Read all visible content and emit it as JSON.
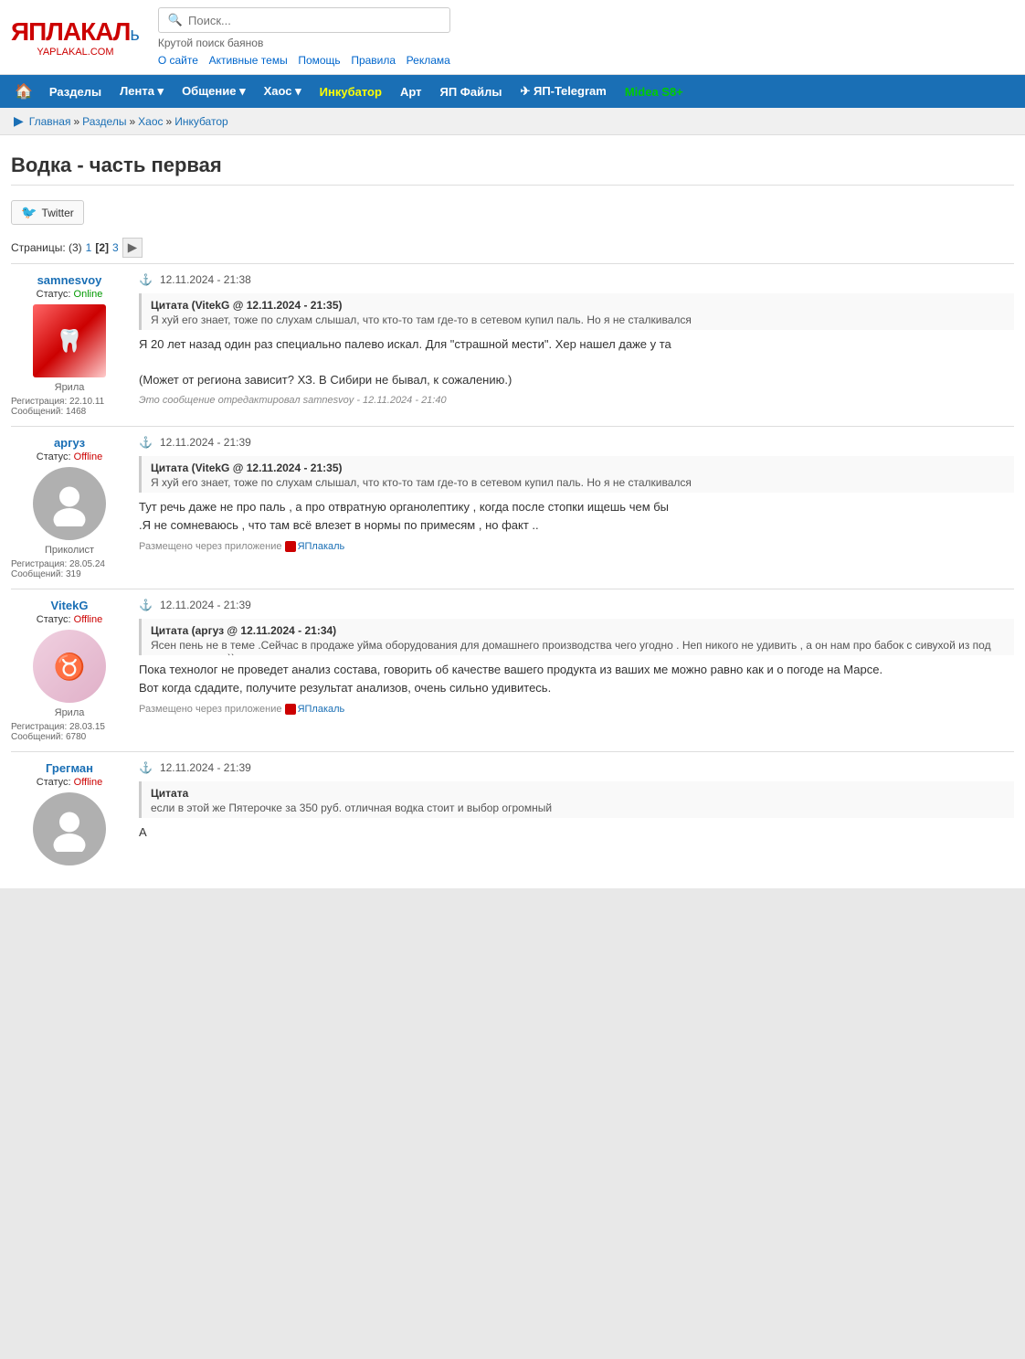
{
  "site": {
    "logo_main": "ЯПЛАКАЛ",
    "logo_sub": "YAPLAKAL.COM",
    "tagline": "Крутой поиск баянов",
    "search_placeholder": "Поиск...",
    "nav_links": [
      {
        "label": "О сайте",
        "url": "#"
      },
      {
        "label": "Активные темы",
        "url": "#"
      },
      {
        "label": "Помощь",
        "url": "#"
      },
      {
        "label": "Правила",
        "url": "#"
      },
      {
        "label": "Реклама",
        "url": "#"
      }
    ]
  },
  "topnav": {
    "items": [
      {
        "label": "Разделы",
        "has_arrow": false
      },
      {
        "label": "Лента",
        "has_arrow": true
      },
      {
        "label": "Общение",
        "has_arrow": true
      },
      {
        "label": "Хаос",
        "has_arrow": true
      },
      {
        "label": "Инкубатор",
        "special": "incubator"
      },
      {
        "label": "Арт",
        "special": "art"
      },
      {
        "label": "ЯП Файлы",
        "special": ""
      },
      {
        "label": "✈ ЯП-Telegram",
        "special": ""
      },
      {
        "label": "Midea S8+",
        "special": "midea"
      }
    ]
  },
  "breadcrumb": {
    "items": [
      {
        "label": "Главная",
        "url": "#"
      },
      {
        "label": "Разделы",
        "url": "#"
      },
      {
        "label": "Хаос",
        "url": "#"
      },
      {
        "label": "Инкубатор",
        "url": "#"
      }
    ]
  },
  "page": {
    "title": "Водка - часть первая",
    "twitter_label": "Twitter",
    "pagination": {
      "total": 3,
      "current": 2,
      "pages": [
        "1",
        "2",
        "3"
      ]
    }
  },
  "posts": [
    {
      "username": "samnesvoy",
      "status": "Online",
      "status_type": "online",
      "avatar_type": "teeth",
      "role": "Ярила",
      "reg_date": "22.10.11",
      "messages": "1468",
      "date": "12.11.2024 - 21:38",
      "has_quote": true,
      "quote_author": "VitekG",
      "quote_date": "12.11.2024 - 21:35",
      "quote_text": "Я хуй его знает, тоже по слухам слышал, что кто-то там где-то в сетевом купил паль. Но я не сталкивался",
      "text": "Я 20 лет назад один раз специально палево искал. Для \"страшной мести\". Хер нашел даже у та\n\n(Может от региона зависит? ХЗ. В Сибири не бывал, к сожалению.)",
      "has_app": false,
      "edit_note": "Это сообщение отредактировал samnesvoy - 12.11.2024 - 21:40"
    },
    {
      "username": "аргуз",
      "status": "Offline",
      "status_type": "offline",
      "avatar_type": "placeholder",
      "role": "Приколист",
      "reg_date": "28.05.24",
      "messages": "319",
      "date": "12.11.2024 - 21:39",
      "has_quote": true,
      "quote_author": "VitekG",
      "quote_date": "12.11.2024 - 21:35",
      "quote_text": "Я хуй его знает, тоже по слухам слышал, что кто-то там где-то в сетевом купил паль. Но я не сталкивался",
      "text": "Тут речь даже не про паль , а про отвратную органолептику , когда после стопки ищешь чем бы\n.Я не сомневаюсь , что там всё влезет в нормы по примесям , но факт ..",
      "has_app": true,
      "app_label": "ЯПлакаль",
      "edit_note": ""
    },
    {
      "username": "VitekG",
      "status": "Offline",
      "status_type": "offline",
      "avatar_type": "bull",
      "role": "Ярила",
      "reg_date": "28.03.15",
      "messages": "6780",
      "date": "12.11.2024 - 21:39",
      "has_quote": true,
      "quote_author": "аргуз",
      "quote_date": "12.11.2024 - 21:34",
      "quote_text": "Ясен пень не в теме .Сейчас в продаже уйма оборудования для домашнего производства чего угодно . Неп никого не удивить , а он нам про бабок с сивухой из под полы затирает ))",
      "text": "Пока технолог не проведет анализ состава, говорить об качестве вашего продукта из ваших ме можно равно как и о погоде на Марсе.\nВот когда сдадите, получите результат анализов, очень сильно удивитесь.",
      "has_app": true,
      "app_label": "ЯПлакаль",
      "edit_note": ""
    },
    {
      "username": "Грегман",
      "status": "Offline",
      "status_type": "offline",
      "avatar_type": "placeholder",
      "role": "",
      "reg_date": "",
      "messages": "",
      "date": "12.11.2024 - 21:39",
      "has_quote": true,
      "quote_author": "",
      "quote_date": "",
      "quote_text": "если в этой же Пятерочке за 350 руб. отличная водка стоит и выбор огромный",
      "text": "А",
      "has_app": false,
      "edit_note": ""
    }
  ],
  "labels": {
    "status_label": "Статус:",
    "reg_label": "Регистрация:",
    "msg_label": "Сообщений:",
    "pages_label": "Страницы:",
    "quote_label": "Цитата",
    "app_via": "Размещено через приложение",
    "edit_prefix": "Это сообщение отредактировал"
  }
}
